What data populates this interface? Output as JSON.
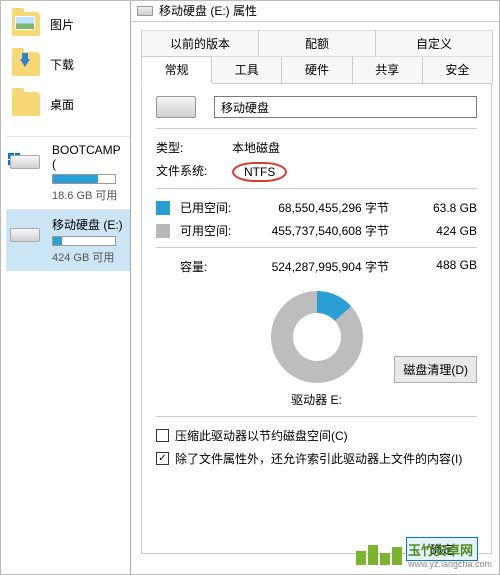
{
  "explorer": {
    "items": [
      {
        "label": "图片"
      },
      {
        "label": "下载"
      },
      {
        "label": "桌面"
      }
    ],
    "drives": [
      {
        "name": "BOOTCAMP (",
        "free_text": "18.6 GB 可用",
        "fill_pct": 72
      },
      {
        "name": "移动硬盘 (E:)",
        "free_text": "424 GB 可用",
        "fill_pct": 14
      }
    ]
  },
  "dialog": {
    "title": "移动硬盘 (E:) 属性",
    "tabs_top": [
      "以前的版本",
      "配额",
      "自定义"
    ],
    "tabs_bottom": [
      "常规",
      "工具",
      "硬件",
      "共享",
      "安全"
    ],
    "drive_name_value": "移动硬盘",
    "type_label": "类型:",
    "type_value": "本地磁盘",
    "fs_label": "文件系统:",
    "fs_value": "NTFS",
    "used_label": "已用空间:",
    "used_bytes": "68,550,455,296 字节",
    "used_gb": "63.8 GB",
    "free_label": "可用空间:",
    "free_bytes": "455,737,540,608 字节",
    "free_gb": "424 GB",
    "capacity_label": "容量:",
    "capacity_bytes": "524,287,995,904 字节",
    "capacity_gb": "488 GB",
    "drive_letter_label": "驱动器 E:",
    "cleanup_btn": "磁盘清理(D)",
    "compress_label": "压缩此驱动器以节约磁盘空间(C)",
    "index_label": "除了文件属性外，还允许索引此驱动器上文件的内容(I)",
    "ok_btn": "确定"
  },
  "watermark": {
    "brand": "玉竹安卓网",
    "url": "www.yz.langcha.com"
  }
}
